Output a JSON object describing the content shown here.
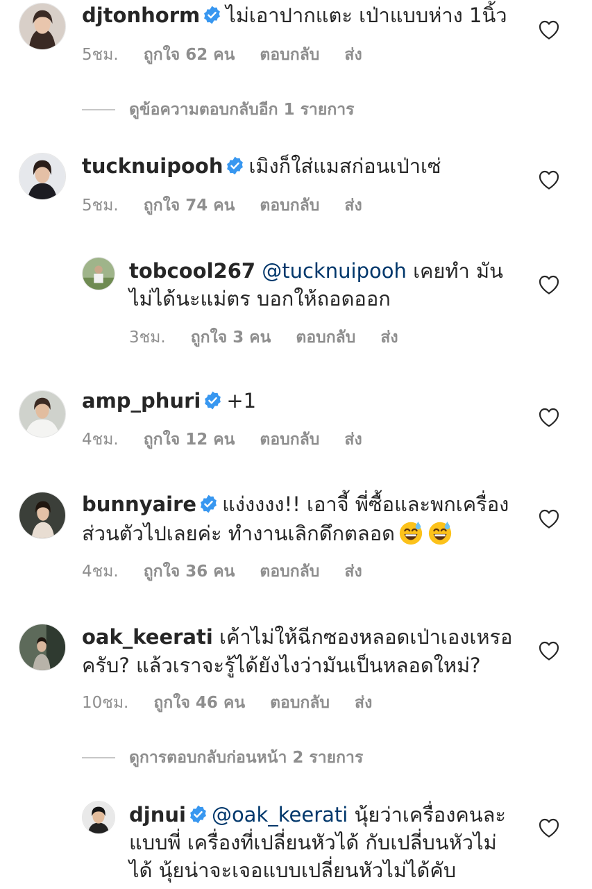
{
  "comments": [
    {
      "username": "djtonhorm",
      "text": "ไม่เอาปากแตะ เป่าแบบห่าง 1นิ้ว",
      "time": "5ชม.",
      "likes": "ถูกใจ 62 คน",
      "reply": "ตอบกลับ",
      "send": "ส่ง"
    },
    {
      "username": "tucknuipooh",
      "text": "เมิงก็ใส่แมสก่อนเป่าเซ่",
      "time": "5ชม.",
      "likes": "ถูกใจ 74 คน",
      "reply": "ตอบกลับ",
      "send": "ส่ง"
    },
    {
      "username": "tobcool267",
      "mention": "@tucknuipooh",
      "text_line1": "เคยทำ มัน",
      "text_line2": "ไม่ได้นะแม่ตร บอกให้ถอดออก",
      "time": "3ชม.",
      "likes": "ถูกใจ 3 คน",
      "reply": "ตอบกลับ",
      "send": "ส่ง"
    },
    {
      "username": "amp_phuri",
      "text": "+1",
      "time": "4ชม.",
      "likes": "ถูกใจ 12 คน",
      "reply": "ตอบกลับ",
      "send": "ส่ง"
    },
    {
      "username": "bunnyaire",
      "text_line1": "แง่งงงง!! เอาจี้ พี่ซื้อและพกเครื่อง",
      "text_line2": "ส่วนตัวไปเลยค่ะ ทำงานเลิกดึกตลอด",
      "time": "4ชม.",
      "likes": "ถูกใจ 36 คน",
      "reply": "ตอบกลับ",
      "send": "ส่ง"
    },
    {
      "username": "oak_keerati",
      "text_line1": "เค้าไม่ให้ฉีกซองหลอดเป่าเองเหรอ",
      "text_line2": "ครับ? แล้วเราจะรู้ได้ยังไงว่ามันเป็นหลอดใหม่?",
      "time": "10ชม.",
      "likes": "ถูกใจ 46 คน",
      "reply": "ตอบกลับ",
      "send": "ส่ง"
    },
    {
      "username": "djnui",
      "mention": "@oak_keerati",
      "text_line1": "นุ้ยว่าเครื่องคนละ",
      "text_line2": "แบบพี่ เครื่องที่เปลี่ยนหัวได้ กับเปลี่บนหัวไม่",
      "text_line3": "ได้  นุ้ยน่าจะเจอแบบเปลี่ยนหัวไม่ได้คับ"
    }
  ],
  "view_more_replies": "ดูข้อความตอบกลับอีก 1 รายการ",
  "view_previous_replies": "ดูการตอบกลับก่อนหน้า 2 รายการ",
  "colors": {
    "text": "#262626",
    "secondary": "#8e8e8e",
    "mention": "#00376b",
    "verified": "#3897f0"
  }
}
